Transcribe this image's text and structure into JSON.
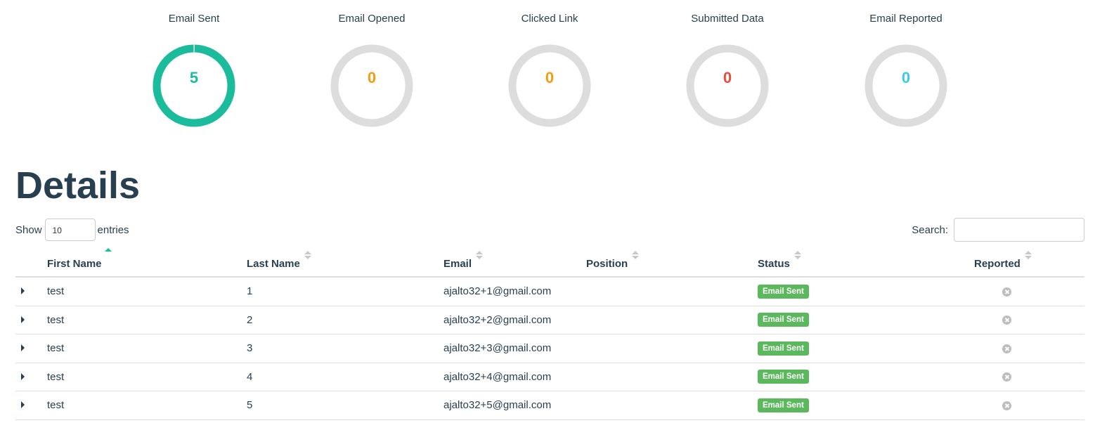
{
  "stats": [
    {
      "title": "Email Sent",
      "value": "5",
      "count": 5,
      "total": 5,
      "color": "#1abc9c",
      "track_color": "#dddddd"
    },
    {
      "title": "Email Opened",
      "value": "0",
      "count": 0,
      "total": 5,
      "color": "#f39c12",
      "track_color": "#dddddd"
    },
    {
      "title": "Clicked Link",
      "value": "0",
      "count": 0,
      "total": 5,
      "color": "#f39c12",
      "track_color": "#dddddd"
    },
    {
      "title": "Submitted Data",
      "value": "0",
      "count": 0,
      "total": 5,
      "color": "#e74c3c",
      "track_color": "#dddddd"
    },
    {
      "title": "Email Reported",
      "value": "0",
      "count": 0,
      "total": 5,
      "color": "#3bc9e9",
      "track_color": "#dddddd"
    }
  ],
  "details": {
    "title": "Details"
  },
  "controls": {
    "show_label": "Show",
    "entries_value": "10",
    "entries_label": "entries",
    "search_label": "Search:",
    "search_value": ""
  },
  "table": {
    "columns": [
      {
        "label": "First Name",
        "sort": "asc"
      },
      {
        "label": "Last Name",
        "sort": "both"
      },
      {
        "label": "Email",
        "sort": "both"
      },
      {
        "label": "Position",
        "sort": "both"
      },
      {
        "label": "Status",
        "sort": "both"
      },
      {
        "label": "Reported",
        "sort": "both"
      }
    ],
    "rows": [
      {
        "first_name": "test",
        "last_name": "1",
        "email": "ajalto32+1@gmail.com",
        "position": "",
        "status": "Email Sent",
        "reported_icon": "times-circle-icon"
      },
      {
        "first_name": "test",
        "last_name": "2",
        "email": "ajalto32+2@gmail.com",
        "position": "",
        "status": "Email Sent",
        "reported_icon": "times-circle-icon"
      },
      {
        "first_name": "test",
        "last_name": "3",
        "email": "ajalto32+3@gmail.com",
        "position": "",
        "status": "Email Sent",
        "reported_icon": "times-circle-icon"
      },
      {
        "first_name": "test",
        "last_name": "4",
        "email": "ajalto32+4@gmail.com",
        "position": "",
        "status": "Email Sent",
        "reported_icon": "times-circle-icon"
      },
      {
        "first_name": "test",
        "last_name": "5",
        "email": "ajalto32+5@gmail.com",
        "position": "",
        "status": "Email Sent",
        "reported_icon": "times-circle-icon"
      }
    ],
    "status_color": "#5cb85c"
  }
}
